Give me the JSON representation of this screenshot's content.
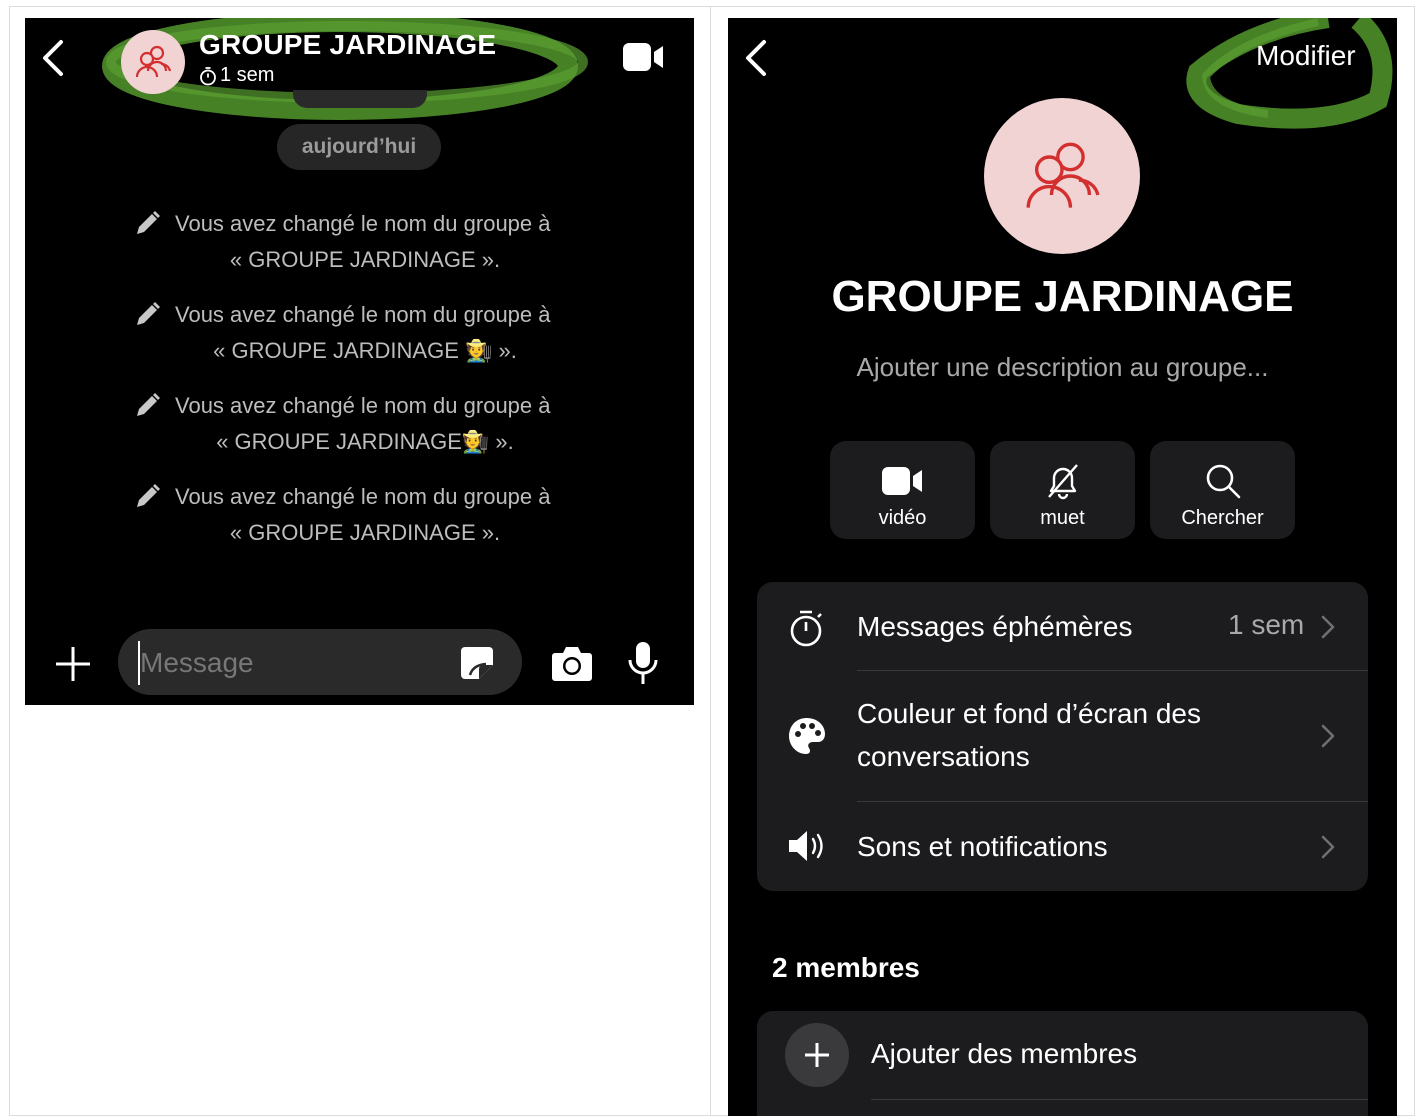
{
  "chat": {
    "title": "GROUPE JARDINAGE",
    "timer": "1 sem",
    "date_separator": "aujourd’hui",
    "system_messages": [
      {
        "line1": "Vous avez changé le nom du groupe à",
        "line2": "« GROUPE JARDINAGE »."
      },
      {
        "line1": "Vous avez changé le nom du groupe à",
        "line2": "« GROUPE JARDINAGE 🧑‍🌾 »."
      },
      {
        "line1": "Vous avez changé le nom du groupe à",
        "line2": "« GROUPE JARDINAGE🧑‍🌾 »."
      },
      {
        "line1": "Vous avez changé le nom du groupe à",
        "line2": "« GROUPE JARDINAGE »."
      }
    ],
    "composer": {
      "placeholder": "Message",
      "value": ""
    }
  },
  "info": {
    "edit_label": "Modifier",
    "group_name": "GROUPE JARDINAGE",
    "description_placeholder": "Ajouter une description au groupe...",
    "actions": [
      {
        "label": "vidéo",
        "icon": "video-icon"
      },
      {
        "label": "muet",
        "icon": "bell-slash-icon"
      },
      {
        "label": "Chercher",
        "icon": "search-icon"
      }
    ],
    "settings": [
      {
        "label": "Messages éphémères",
        "value": "1 sem",
        "icon": "timer-icon"
      },
      {
        "label_line1": "Couleur et fond d’écran des",
        "label_line2": "conversations",
        "icon": "palette-icon"
      },
      {
        "label": "Sons et notifications",
        "icon": "speaker-icon"
      }
    ],
    "members_title": "2 membres",
    "add_members_label": "Ajouter des membres"
  },
  "colors": {
    "background": "#000000",
    "card": "#1c1c1e",
    "avatar_bg": "#f2d3d4",
    "avatar_icon": "#d32f2f",
    "annotation_green": "#4f8f2a"
  }
}
